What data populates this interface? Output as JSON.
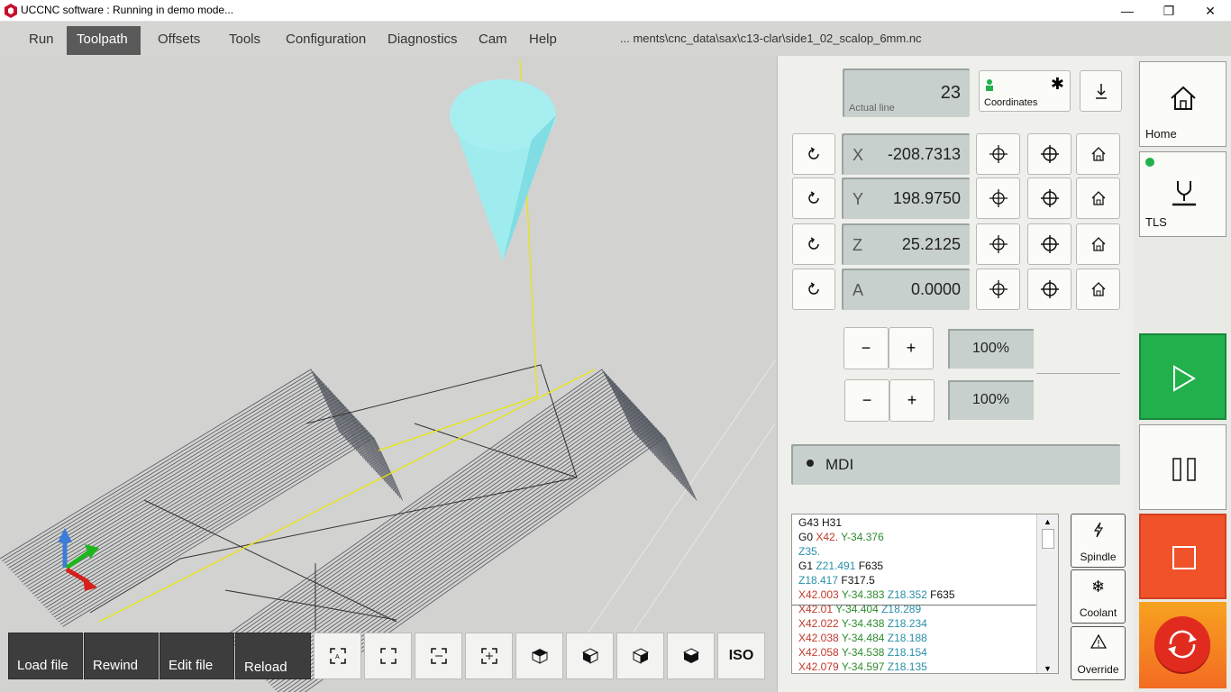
{
  "window": {
    "title": "UCCNC software : Running in demo mode..."
  },
  "menu": {
    "items": [
      "Run",
      "Toolpath",
      "Offsets",
      "Tools",
      "Configuration",
      "Diagnostics",
      "Cam",
      "Help"
    ],
    "active": "Toolpath",
    "filepath": "... ments\\cnc_data\\sax\\c13-clar\\side1_02_scalop_6mm.nc"
  },
  "toolbar": {
    "load": "Load file",
    "rewind": "Rewind",
    "edit": "Edit file",
    "reload": "Reload",
    "iso": "ISO"
  },
  "actual_line": {
    "value": "23",
    "label": "Actual line"
  },
  "coordinates_label": "Coordinates",
  "dro": [
    {
      "axis": "X",
      "value": "-208.7313"
    },
    {
      "axis": "Y",
      "value": "198.9750"
    },
    {
      "axis": "Z",
      "value": "25.2125"
    },
    {
      "axis": "A",
      "value": "0.0000"
    }
  ],
  "overrides": {
    "feed": "100%",
    "spindle": "100%",
    "minus": "−",
    "plus": "+"
  },
  "mdi": {
    "label": "MDI"
  },
  "gcode_lines": [
    [
      {
        "t": "G43 H31",
        "c": "k"
      }
    ],
    [
      {
        "t": "G0 ",
        "c": "k"
      },
      {
        "t": "X42.",
        "c": "r"
      },
      {
        "t": " Y-34.376",
        "c": "g"
      }
    ],
    [
      {
        "t": "Z35.",
        "c": "b"
      }
    ],
    [
      {
        "t": "G1 ",
        "c": "k"
      },
      {
        "t": "Z21.491",
        "c": "b"
      },
      {
        "t": " F635",
        "c": "k"
      }
    ],
    [
      {
        "t": "Z18.417",
        "c": "b"
      },
      {
        "t": " F317.5",
        "c": "k"
      }
    ],
    [
      {
        "t": "X42.003",
        "c": "r"
      },
      {
        "t": " Y-34.383",
        "c": "g"
      },
      {
        "t": " Z18.352",
        "c": "b"
      },
      {
        "t": " F635",
        "c": "k"
      }
    ],
    [
      {
        "t": "X42.01",
        "c": "r"
      },
      {
        "t": " Y-34.404",
        "c": "g"
      },
      {
        "t": " Z18.289",
        "c": "b"
      }
    ],
    [
      {
        "t": "X42.022",
        "c": "r"
      },
      {
        "t": " Y-34.438",
        "c": "g"
      },
      {
        "t": " Z18.234",
        "c": "b"
      }
    ],
    [
      {
        "t": "X42.038",
        "c": "r"
      },
      {
        "t": " Y-34.484",
        "c": "g"
      },
      {
        "t": " Z18.188",
        "c": "b"
      }
    ],
    [
      {
        "t": "X42.058",
        "c": "r"
      },
      {
        "t": " Y-34.538",
        "c": "g"
      },
      {
        "t": " Z18.154",
        "c": "b"
      }
    ],
    [
      {
        "t": "X42.079",
        "c": "r"
      },
      {
        "t": " Y-34.597",
        "c": "g"
      },
      {
        "t": " Z18.135",
        "c": "b"
      }
    ]
  ],
  "side_buttons": {
    "spindle": "Spindle",
    "coolant": "Coolant",
    "override": "Override"
  },
  "right_buttons": {
    "home": "Home",
    "tls": "TLS"
  },
  "colors": {
    "x": "#c0392b",
    "y": "#2e8b2e",
    "z": "#2a8fa8",
    "start": "#22b04c",
    "stop": "#f0522a",
    "reset": "#f36b22"
  }
}
